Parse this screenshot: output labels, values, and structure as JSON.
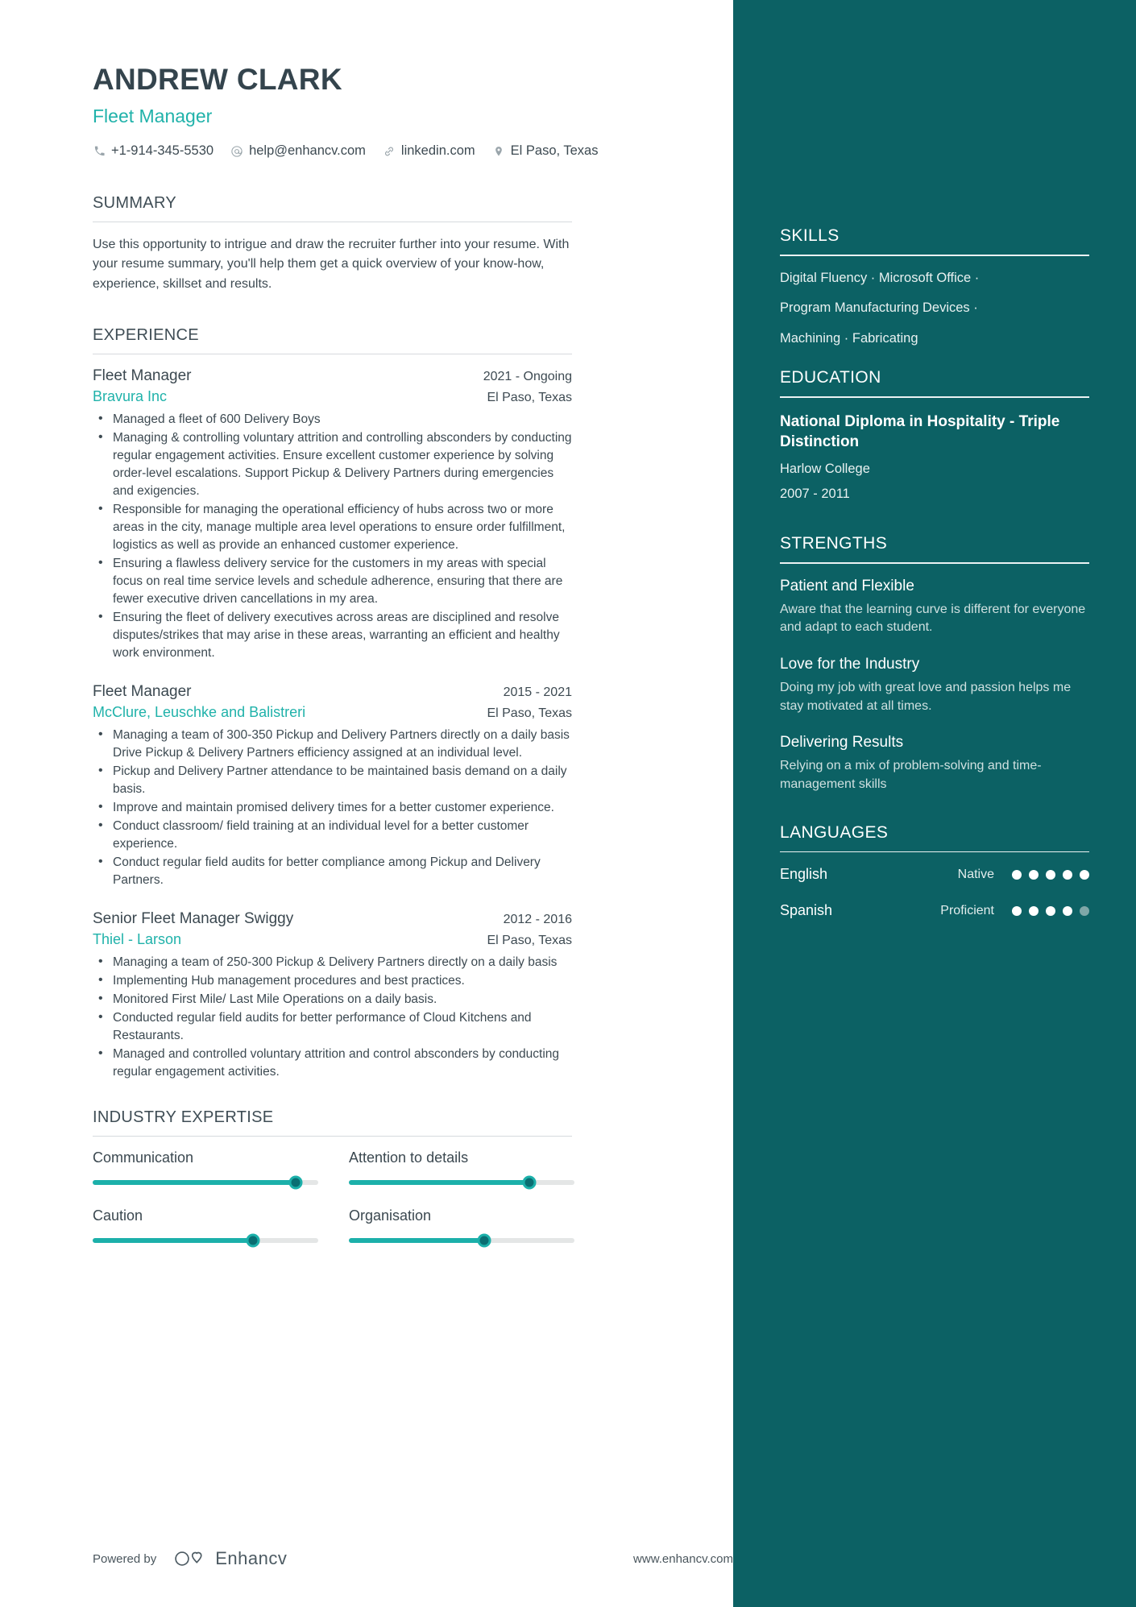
{
  "header": {
    "name": "ANDREW CLARK",
    "role": "Fleet Manager",
    "contacts": [
      {
        "icon": "phone-icon",
        "text": "+1-914-345-5530"
      },
      {
        "icon": "email-icon",
        "text": "help@enhancv.com"
      },
      {
        "icon": "link-icon",
        "text": "linkedin.com"
      },
      {
        "icon": "location-pin-icon",
        "text": "El Paso, Texas"
      }
    ]
  },
  "summary": {
    "title": "SUMMARY",
    "text": "Use this opportunity to intrigue and draw the recruiter further into your resume. With your resume summary, you'll help them get a quick overview of your know-how, experience, skillset and results."
  },
  "experience": {
    "title": "EXPERIENCE",
    "jobs": [
      {
        "title": "Fleet Manager",
        "date": "2021 - Ongoing",
        "company": "Bravura Inc",
        "location": "El Paso, Texas",
        "bullets": [
          "Managed a fleet of  600 Delivery Boys",
          "Managing & controlling voluntary attrition and controlling absconders by conducting regular engagement activities. Ensure  excellent customer experience by solving order-level escalations. Support Pickup & Delivery Partners during emergencies  and exigencies.",
          "Responsible for managing the operational efficiency of hubs across two or more areas in the city, manage multiple area  level operations to ensure order fulfillment, logistics as well as provide an enhanced customer experience.",
          "Ensuring a flawless delivery service for the customers in my areas with special focus on real time service levels and  schedule adherence, ensuring that there are fewer executive driven cancellations in my area.",
          "Ensuring the fleet of delivery executives across areas are disciplined and resolve disputes/strikes that may arise in these  areas, warranting an efficient and healthy work environment."
        ]
      },
      {
        "title": "Fleet Manager",
        "date": "2015 - 2021",
        "company": "McClure, Leuschke and Balistreri",
        "location": "El Paso, Texas",
        "bullets": [
          "Managing a team of 300-350 Pickup and Delivery Partners directly on a daily basis Drive Pickup & Delivery Partners efficiency assigned at an individual level.",
          "Pickup and Delivery Partner attendance to be maintained basis demand on a daily basis.",
          " Improve and maintain promised delivery times for a better customer experience.",
          "Conduct classroom/ field training at an individual level for a better customer experience.",
          " Conduct regular field audits for better compliance among Pickup and Delivery Partners."
        ]
      },
      {
        "title": "Senior Fleet Manager Swiggy",
        "date": "2012 - 2016",
        "company": "Thiel - Larson",
        "location": "El Paso, Texas",
        "bullets": [
          "Managing a team of 250-300 Pickup & Delivery Partners directly on a daily basis",
          " Implementing Hub management procedures and best practices.",
          "Monitored First Mile/ Last Mile Operations on a daily basis.",
          "Conducted regular field audits for better performance of Cloud Kitchens and Restaurants.",
          "Managed and controlled voluntary attrition and control absconders by conducting regular engagement activities."
        ]
      }
    ]
  },
  "industry_expertise": {
    "title": "INDUSTRY EXPERTISE",
    "items": [
      {
        "label": "Communication",
        "value": 90
      },
      {
        "label": "Attention to details",
        "value": 80
      },
      {
        "label": "Caution",
        "value": 71
      },
      {
        "label": "Organisation",
        "value": 60
      }
    ]
  },
  "sidebar": {
    "skills": {
      "title": "SKILLS",
      "lines": [
        "Digital Fluency · Microsoft Office ·",
        "Program Manufacturing Devices ·",
        "Machining · Fabricating"
      ]
    },
    "education": {
      "title": "EDUCATION",
      "degree": "National Diploma in Hospitality - Triple Distinction",
      "school": "Harlow College",
      "date": "2007 - 2011"
    },
    "strengths": {
      "title": "STRENGTHS",
      "items": [
        {
          "title": "Patient and Flexible",
          "desc": "Aware that the learning curve is different for everyone and adapt to each student."
        },
        {
          "title": "Love for the Industry",
          "desc": "Doing my job with great love and passion helps me stay motivated at all times."
        },
        {
          "title": "Delivering Results",
          "desc": "Relying on a mix of problem-solving and time-management skills"
        }
      ]
    },
    "languages": {
      "title": "LANGUAGES",
      "items": [
        {
          "name": "English",
          "level": "Native",
          "dots": 5,
          "total": 5
        },
        {
          "name": "Spanish",
          "level": "Proficient",
          "dots": 4,
          "total": 5
        }
      ]
    }
  },
  "footer": {
    "powered_label": "Powered by",
    "brand": "Enhancv",
    "site": "www.enhancv.com"
  },
  "colors": {
    "teal_panel": "#0c6164",
    "accent": "#20b2aa",
    "slider_fill": "#1cb0aa",
    "text": "#3d4a52"
  }
}
